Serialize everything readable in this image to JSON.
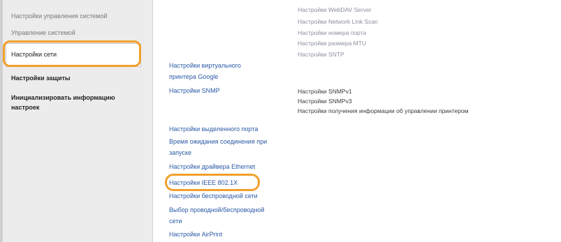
{
  "sidebar": {
    "items": [
      {
        "label": "Настройки управления системой"
      },
      {
        "label": "Управление системой"
      },
      {
        "label": "Настройки сети"
      },
      {
        "label": "Настройки защиты"
      },
      {
        "label": "Инициализировать информацию"
      },
      {
        "label": "настроек"
      }
    ]
  },
  "top_list": [
    "Настройки WebDAV Server",
    "Настройки Network Link Scan",
    "Настройки номера порта",
    "Настройки размера MTU",
    "Настройки SNTP"
  ],
  "main_links": {
    "google_print_1": "Настройки виртуального",
    "google_print_2": "принтера Google",
    "snmp": "Настройки SNMP",
    "dedicated_port": "Настройки выделенного порта",
    "wait_time_1": "Время ожидания соединения при",
    "wait_time_2": "запуске",
    "ethernet_driver": "Настройки драйвера Ethernet",
    "ieee": "Настройки IEEE 802.1X",
    "wireless": "Настройки беспроводной сети",
    "wired_wireless_1": "Выбор проводной/беспроводной",
    "wired_wireless_2": "сети",
    "airprint": "Настройки AirPrint"
  },
  "snmp_sub": [
    "Настройки SNMPv1",
    "Настройки SNMPv3",
    "Настройки получения информации об управлении принтером"
  ],
  "colors": {
    "highlight": "#f2a02c",
    "link": "#2b5aa6",
    "sidebar_bg": "#ececec"
  }
}
